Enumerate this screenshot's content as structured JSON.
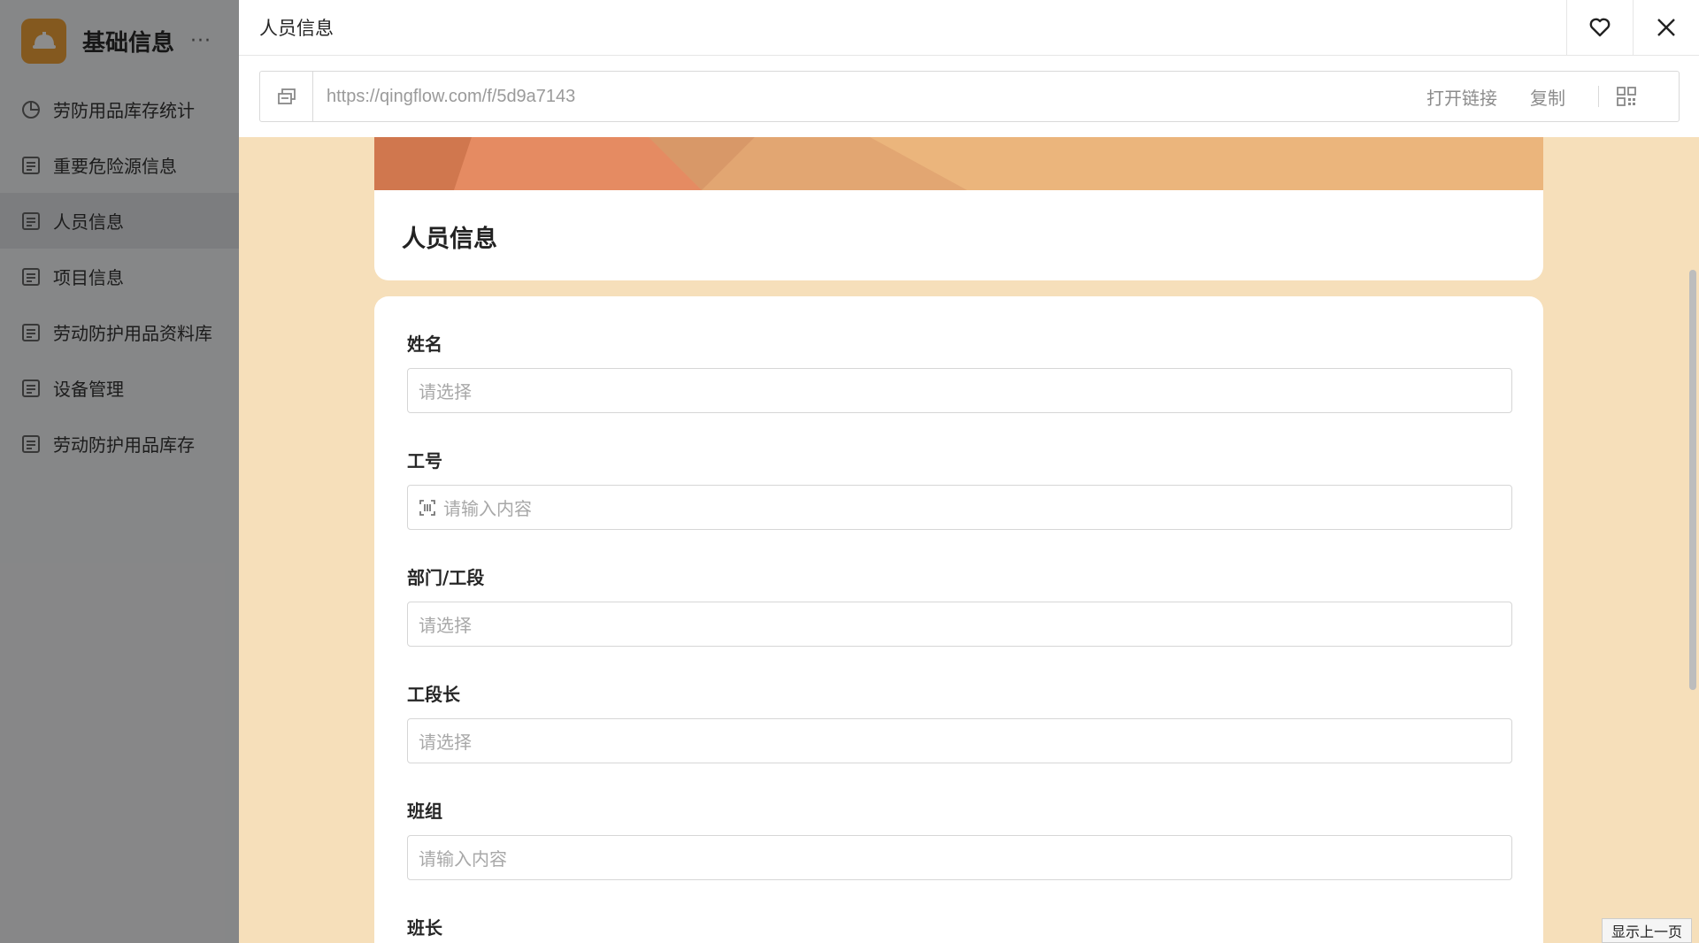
{
  "sidebar": {
    "app_title": "基础信息",
    "more": "···",
    "items": [
      {
        "label": "劳防用品库存统计",
        "icon": "chart-pie-icon"
      },
      {
        "label": "重要危险源信息",
        "icon": "form-icon"
      },
      {
        "label": "人员信息",
        "icon": "form-icon",
        "active": true
      },
      {
        "label": "项目信息",
        "icon": "form-icon"
      },
      {
        "label": "劳动防护用品资料库",
        "icon": "form-icon"
      },
      {
        "label": "设备管理",
        "icon": "form-icon"
      },
      {
        "label": "劳动防护用品库存",
        "icon": "form-icon"
      }
    ]
  },
  "drawer": {
    "title": "人员信息",
    "link": {
      "url": "https://qingflow.com/f/5d9a7143",
      "open_label": "打开链接",
      "copy_label": "复制"
    }
  },
  "form": {
    "title": "人员信息",
    "fields": [
      {
        "label": "姓名",
        "placeholder": "请选择"
      },
      {
        "label": "工号",
        "placeholder": "请输入内容",
        "prefix_icon": "barcode-icon"
      },
      {
        "label": "部门/工段",
        "placeholder": "请选择"
      },
      {
        "label": "工段长",
        "placeholder": "请选择"
      },
      {
        "label": "班组",
        "placeholder": "请输入内容"
      },
      {
        "label": "班长"
      }
    ]
  },
  "footer": {
    "prev_page": "显示上一页"
  },
  "colors": {
    "accent": "#f0a23a",
    "drawer_bg": "#f6dfba"
  }
}
